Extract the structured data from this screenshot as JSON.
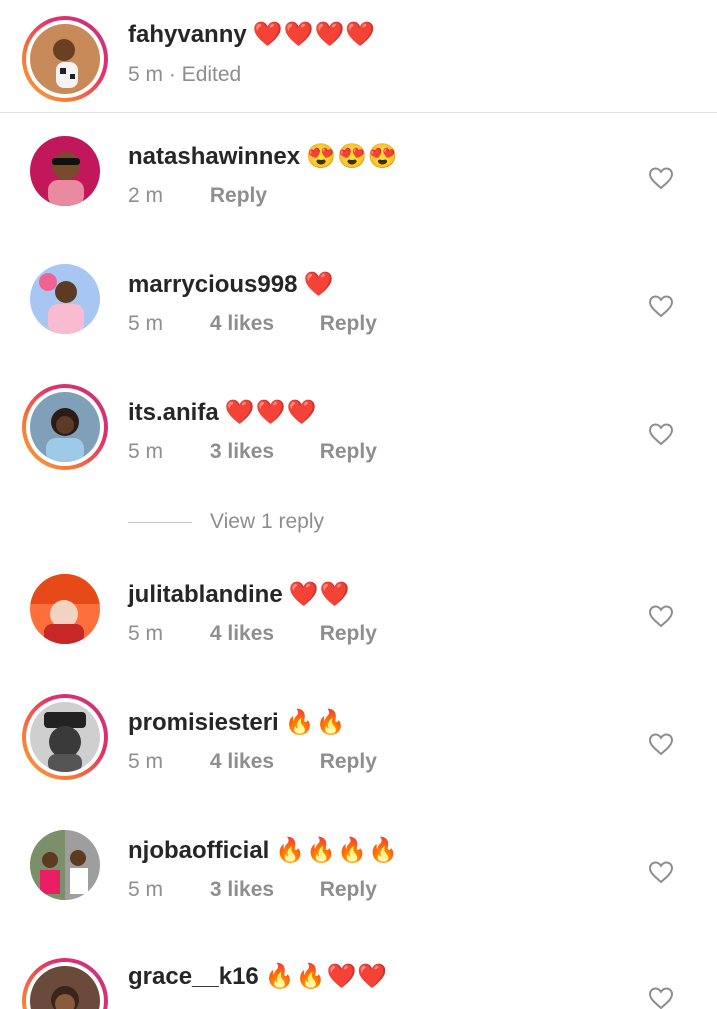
{
  "caption": {
    "username": "fahyvanny",
    "emojis": "❤️❤️❤️❤️",
    "time": "5 m",
    "edited": "· Edited"
  },
  "comments": [
    {
      "username": "natashawinnex",
      "emojis": "😍😍😍",
      "time": "2 m",
      "likes": "",
      "reply": "Reply",
      "story_ring": false
    },
    {
      "username": "marrycious998",
      "emojis": "❤️",
      "time": "5 m",
      "likes": "4 likes",
      "reply": "Reply",
      "story_ring": false
    },
    {
      "username": "its.anifa",
      "emojis": "❤️❤️❤️",
      "time": "5 m",
      "likes": "3 likes",
      "reply": "Reply",
      "story_ring": true
    },
    {
      "username": "julitablandine",
      "emojis": "❤️❤️",
      "time": "5 m",
      "likes": "4 likes",
      "reply": "Reply",
      "story_ring": false
    },
    {
      "username": "promisiesteri",
      "emojis": "🔥🔥",
      "time": "5 m",
      "likes": "4 likes",
      "reply": "Reply",
      "story_ring": true
    },
    {
      "username": "njobaofficial",
      "emojis": "🔥🔥🔥🔥",
      "time": "5 m",
      "likes": "3 likes",
      "reply": "Reply",
      "story_ring": false
    },
    {
      "username": "grace__k16",
      "emojis": "🔥🔥❤️❤️",
      "time": "",
      "likes": "",
      "reply": "",
      "story_ring": true
    }
  ],
  "view_replies": "View 1 reply",
  "icons": {
    "like": "heart-outline-icon"
  },
  "colors": {
    "text": "#262626",
    "secondary": "#8e8e8e",
    "ring_start": "#f9a03f",
    "ring_end": "#c13584"
  }
}
